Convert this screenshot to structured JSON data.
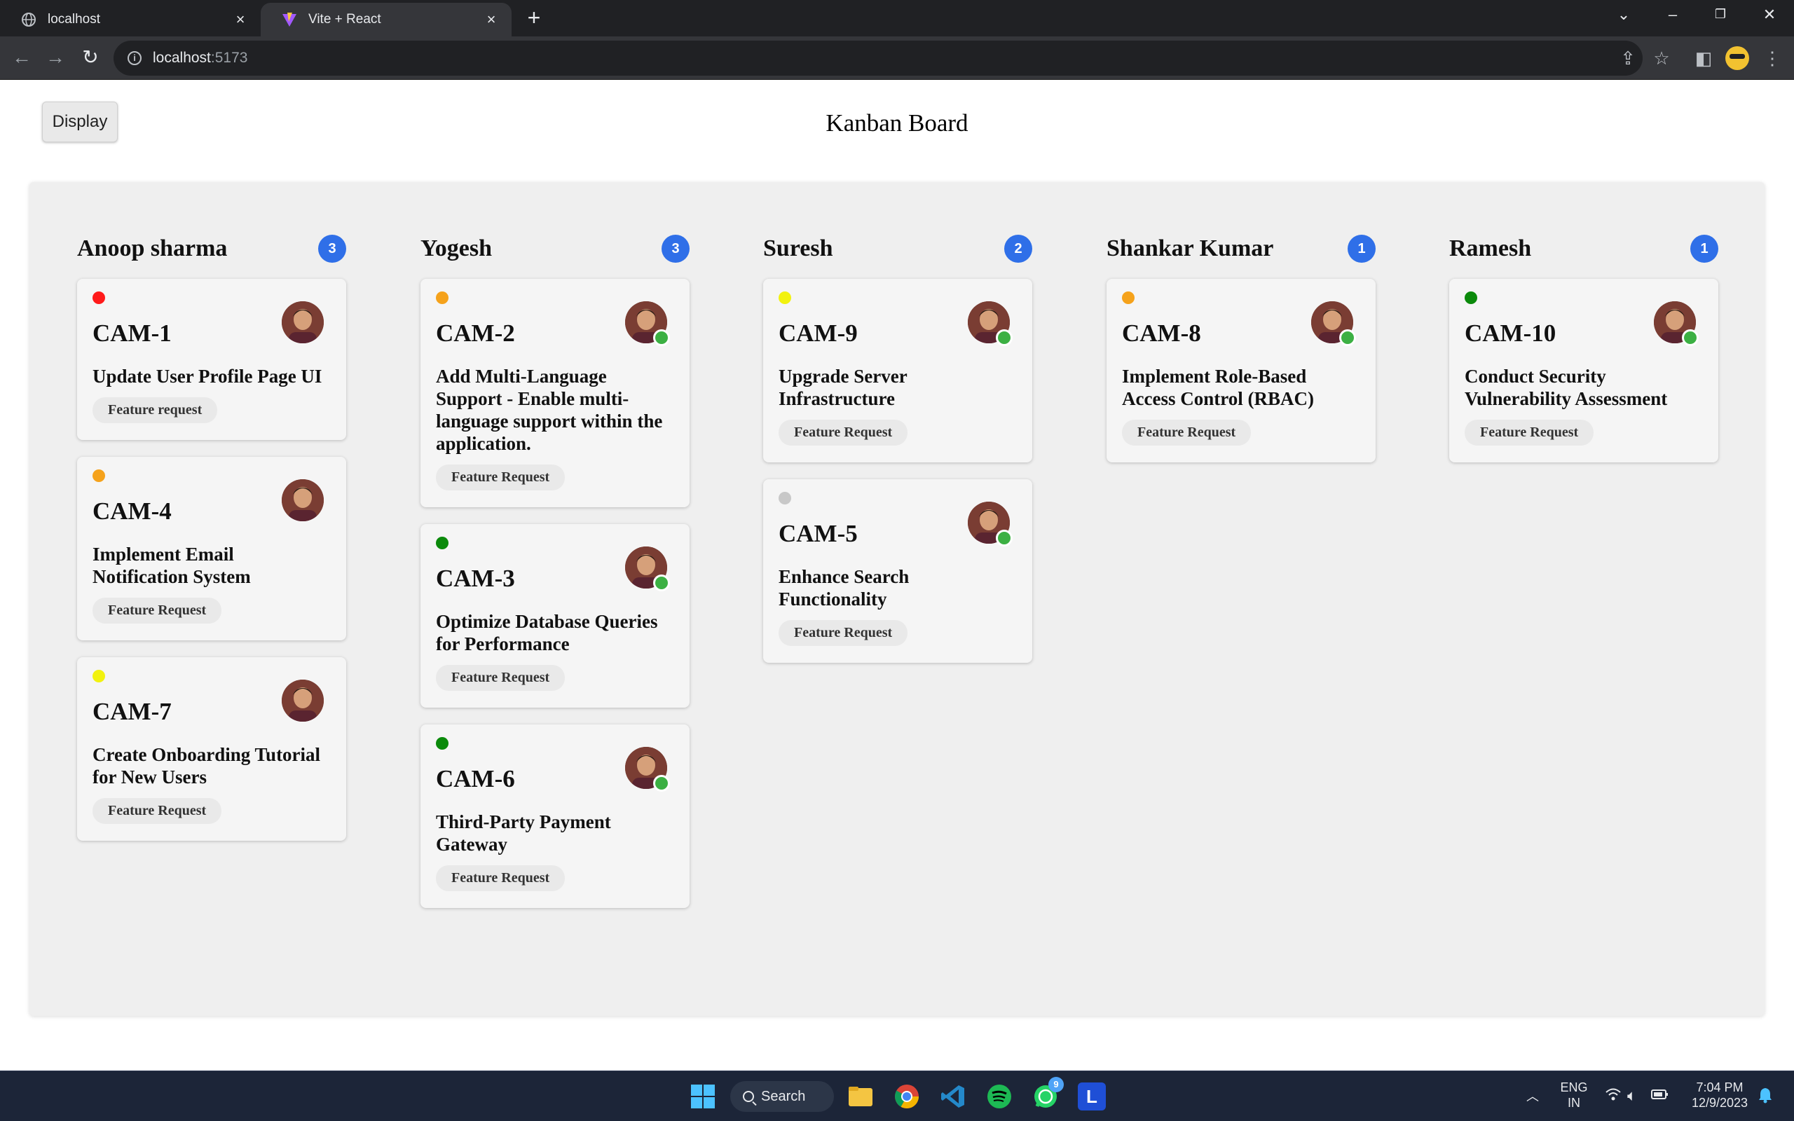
{
  "browser": {
    "tabs": [
      {
        "title": "localhost",
        "icon": "globe-icon",
        "active": false
      },
      {
        "title": "Vite + React",
        "icon": "vite-icon",
        "active": true
      }
    ],
    "url_host": "localhost",
    "url_port": ":5173"
  },
  "page": {
    "display_button": "Display",
    "title": "Kanban Board"
  },
  "priority_colors": {
    "urgent": "#ff1a1a",
    "high": "#f5a21b",
    "medium": "#f2f20f",
    "low": "#0b8a0b",
    "none": "#c8c8c8"
  },
  "accent_color": "#2f6fe8",
  "board": {
    "columns": [
      {
        "name": "Anoop sharma",
        "count": "3",
        "cards": [
          {
            "id": "CAM-1",
            "title": "Update User Profile Page UI",
            "tag": "Feature request",
            "priority": "urgent",
            "online": false
          },
          {
            "id": "CAM-4",
            "title": "Implement Email Notification System",
            "tag": "Feature Request",
            "priority": "high",
            "online": false
          },
          {
            "id": "CAM-7",
            "title": "Create Onboarding Tutorial for New Users",
            "tag": "Feature Request",
            "priority": "medium",
            "online": false
          }
        ]
      },
      {
        "name": "Yogesh",
        "count": "3",
        "cards": [
          {
            "id": "CAM-2",
            "title": "Add Multi-Language Support - Enable multi-language support within the application.",
            "tag": "Feature Request",
            "priority": "high",
            "online": true
          },
          {
            "id": "CAM-3",
            "title": "Optimize Database Queries for Performance",
            "tag": "Feature Request",
            "priority": "low",
            "online": true
          },
          {
            "id": "CAM-6",
            "title": "Third-Party Payment Gateway",
            "tag": "Feature Request",
            "priority": "low",
            "online": true
          }
        ]
      },
      {
        "name": "Suresh",
        "count": "2",
        "cards": [
          {
            "id": "CAM-9",
            "title": "Upgrade Server Infrastructure",
            "tag": "Feature Request",
            "priority": "medium",
            "online": true
          },
          {
            "id": "CAM-5",
            "title": "Enhance Search Functionality",
            "tag": "Feature Request",
            "priority": "none",
            "online": true
          }
        ]
      },
      {
        "name": "Shankar Kumar",
        "count": "1",
        "cards": [
          {
            "id": "CAM-8",
            "title": "Implement Role-Based Access Control (RBAC)",
            "tag": "Feature Request",
            "priority": "high",
            "online": true
          }
        ]
      },
      {
        "name": "Ramesh",
        "count": "1",
        "cards": [
          {
            "id": "CAM-10",
            "title": "Conduct Security Vulnerability Assessment",
            "tag": "Feature Request",
            "priority": "low",
            "online": true
          }
        ]
      }
    ]
  },
  "taskbar": {
    "search_label": "Search",
    "language": "ENG",
    "region": "IN",
    "time": "7:04 PM",
    "date": "12/9/2023",
    "whatsapp_badge": "9",
    "apps": [
      "windows-start-icon",
      "file-explorer-icon",
      "chrome-icon",
      "vscode-icon",
      "spotify-icon",
      "whatsapp-icon",
      "l-app-icon"
    ]
  }
}
